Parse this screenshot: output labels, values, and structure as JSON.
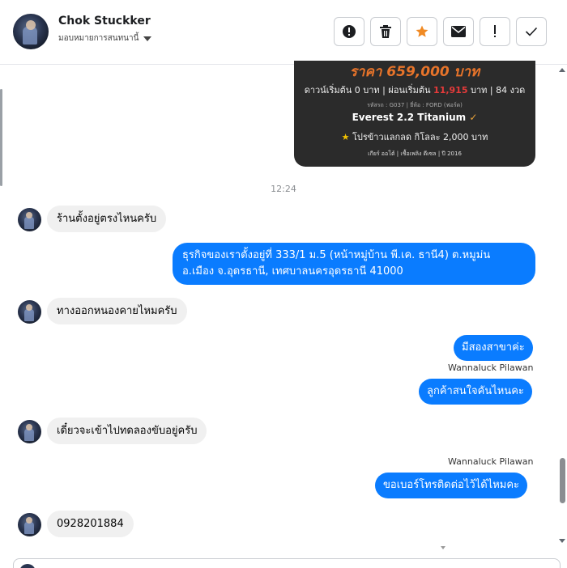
{
  "header": {
    "contact_name": "Chok Stuckker",
    "assign_label": "มอบหมายการสนทนานี้"
  },
  "toolbar": {
    "buttons": [
      {
        "name": "report-button",
        "icon": "alert-circle-icon"
      },
      {
        "name": "delete-button",
        "icon": "trash-icon"
      },
      {
        "name": "star-button",
        "icon": "star-icon",
        "color": "#f08a24"
      },
      {
        "name": "mail-button",
        "icon": "envelope-icon"
      },
      {
        "name": "important-button",
        "icon": "exclamation-icon"
      },
      {
        "name": "done-button",
        "icon": "check-icon"
      }
    ]
  },
  "promo": {
    "price": "ราคา 659,000 บาท",
    "down_prefix": "ดาวน์เริ่มต้น 0 บาท | ผ่อนเริ่มต้น",
    "installment": "11,915",
    "down_suffix": "บาท | 84 งวด",
    "code_brand": "รหัสรถ : G037 | ยี่ห้อ : FORD (ฟอร์ด)",
    "model": "Everest 2.2 Titanium",
    "promo_text": "โปรข้าวแลกลด กิโลละ 2,000 บาท",
    "specs": "เกียร์ ออโต้ | เชื้อเพลิง ดีเซล | ปี 2016"
  },
  "timestamp": "12:24",
  "messages": [
    {
      "dir": "in",
      "text": "ร้านตั้งอยู่ตรงไหนครับ"
    },
    {
      "dir": "out",
      "line1": "ธุรกิจของเราตั้งอยู่ที่ 333/1 ม.5 (หน้าหมู่บ้าน พี.เค. ธานี4) ต.หมูม่น",
      "line2": "อ.เมือง จ.อุดรธานี, เทศบาลนครอุดรธานี 41000"
    },
    {
      "dir": "in",
      "text": "ทางออกหนองคายไหมครับ"
    },
    {
      "dir": "out",
      "text": "มีสองสาขาค่ะ"
    },
    {
      "dir": "sender",
      "text": "Wannaluck Pilawan"
    },
    {
      "dir": "out",
      "text": "ลูกค้าสนใจคันไหนคะ"
    },
    {
      "dir": "in",
      "text": "เดี๋ยวจะเข้าไปทดลองขับอยู่ครับ"
    },
    {
      "dir": "sender",
      "text": "Wannaluck Pilawan"
    },
    {
      "dir": "out",
      "text": "ขอเบอร์โทรติดต่อไว้ได้ไหมคะ"
    },
    {
      "dir": "in",
      "text": "0928201884"
    }
  ]
}
